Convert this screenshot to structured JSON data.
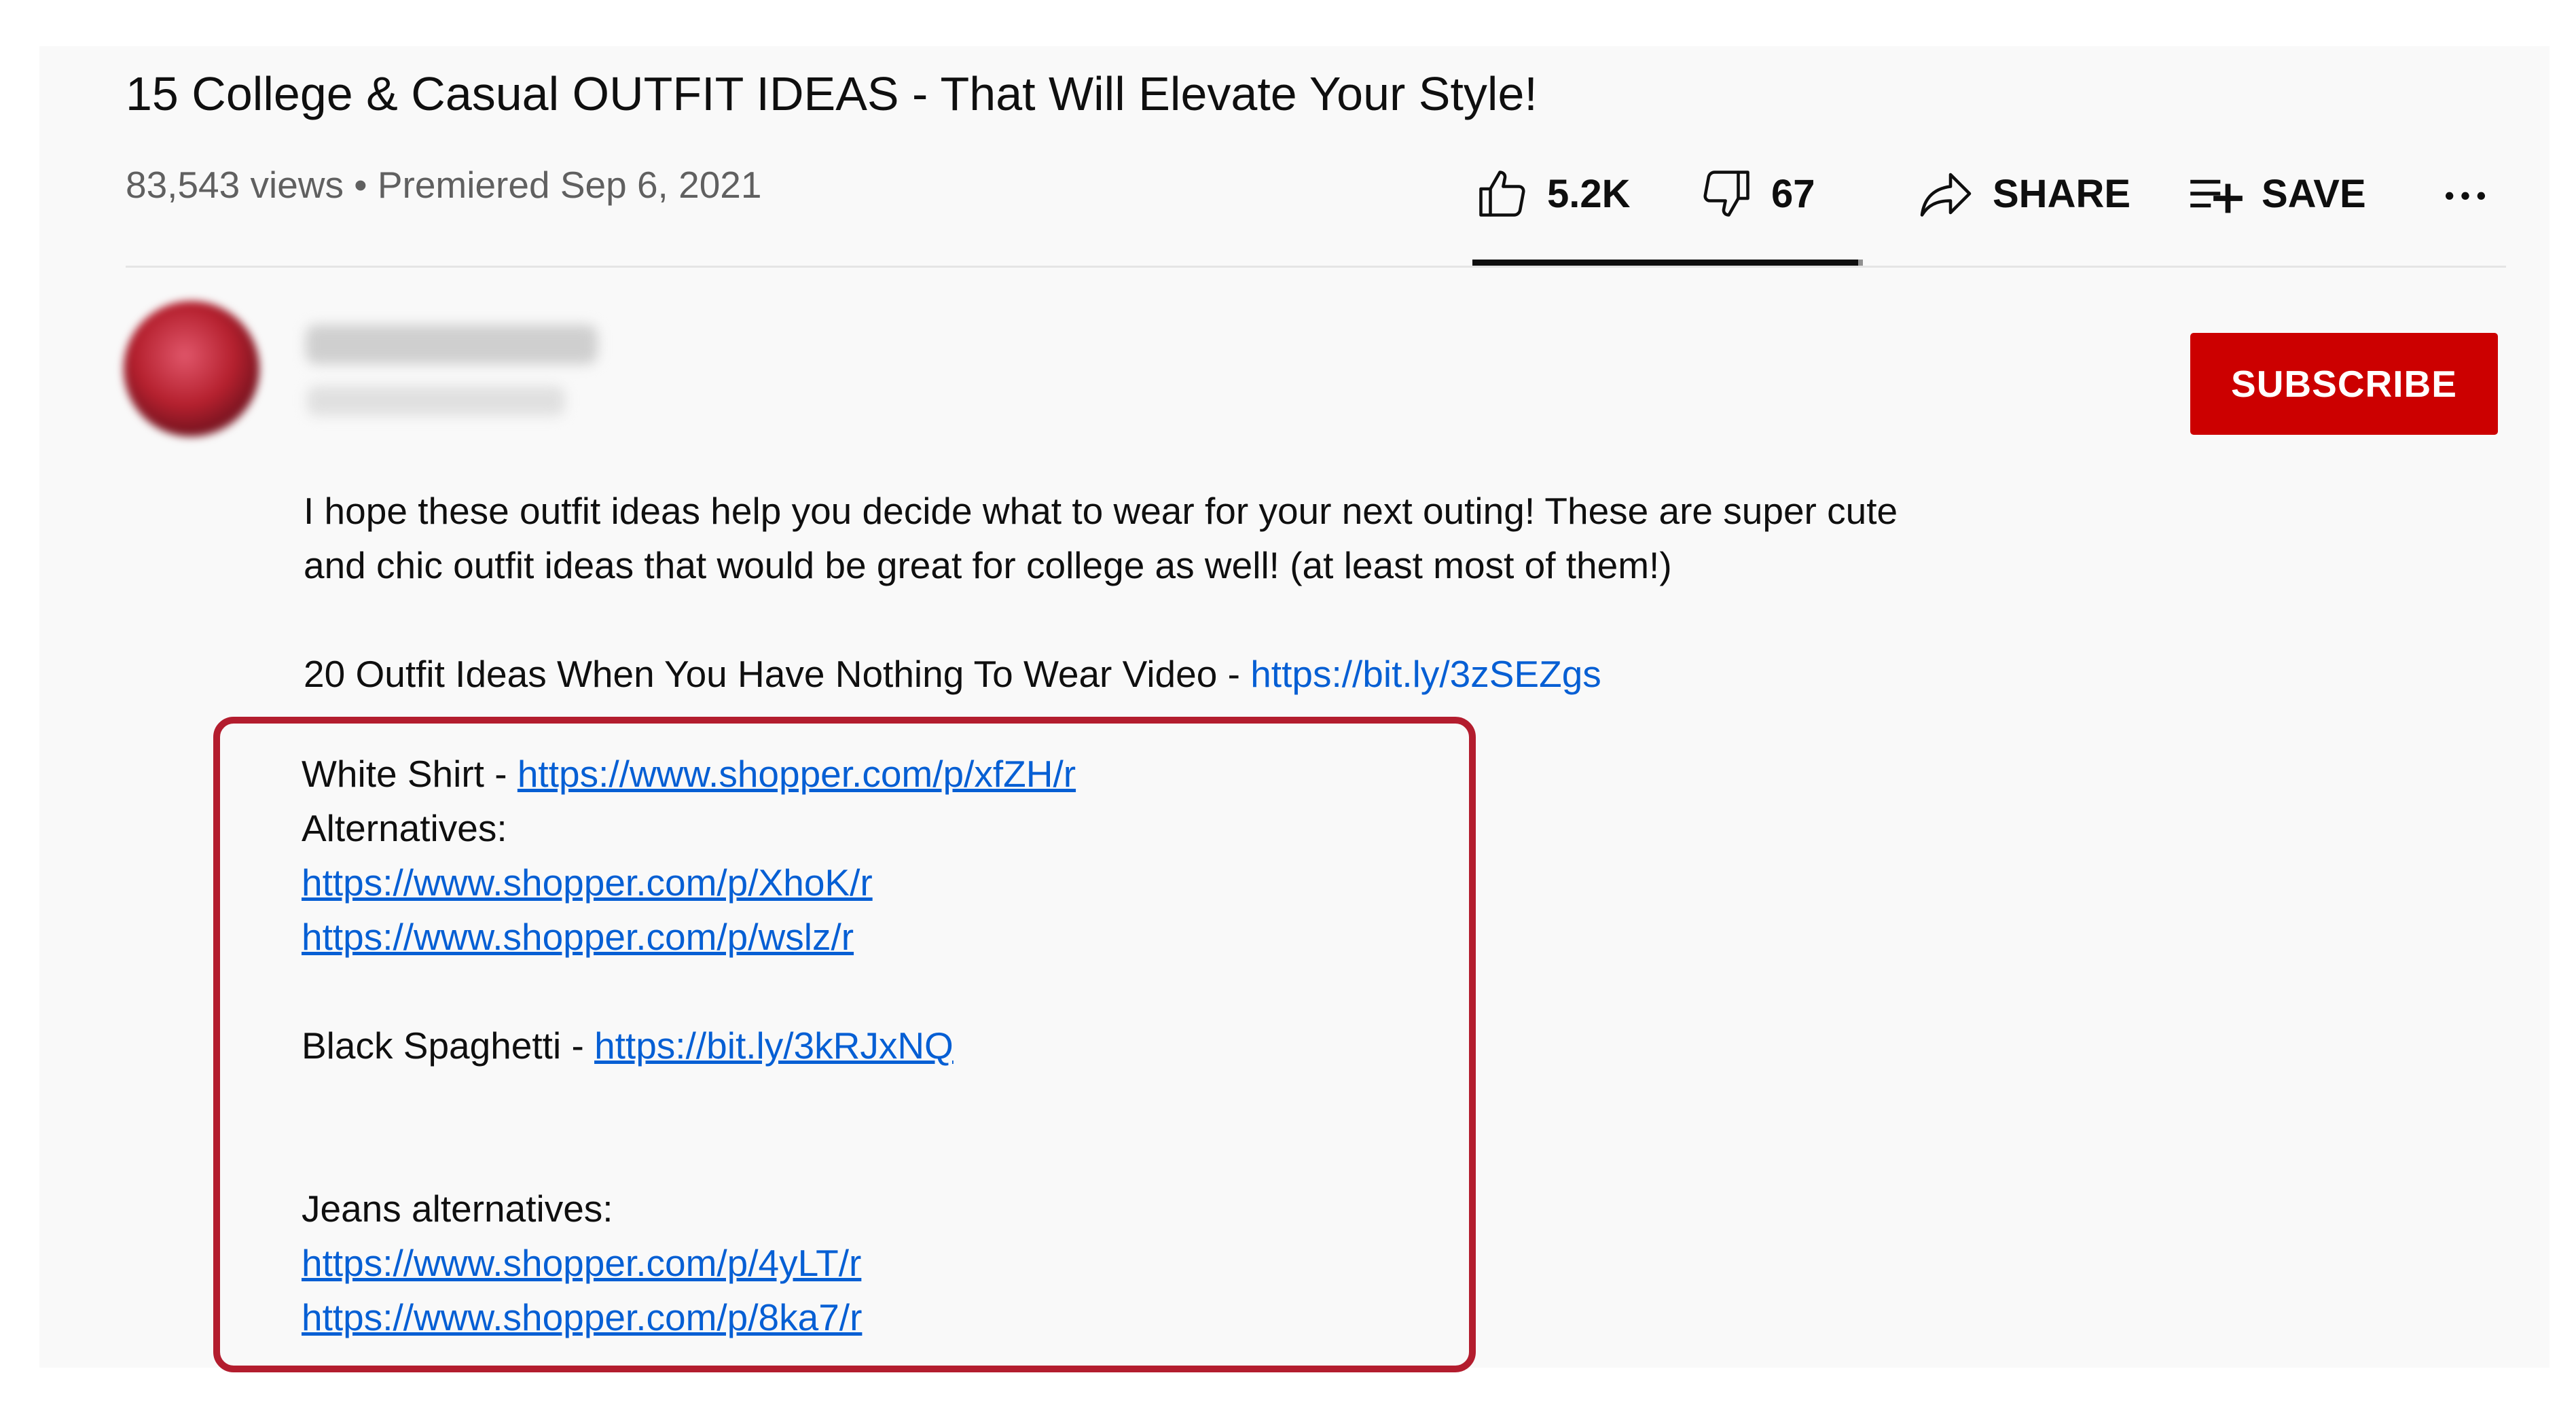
{
  "video": {
    "title": "15 College & Casual OUTFIT IDEAS - That Will Elevate Your Style!",
    "meta": "83,543 views • Premiered Sep 6, 2021"
  },
  "actions": {
    "like_count": "5.2K",
    "dislike_count": "67",
    "share_label": "SHARE",
    "save_label": "SAVE",
    "like_icon": "thumbs-up-icon",
    "dislike_icon": "thumbs-down-icon",
    "share_icon": "share-arrow-icon",
    "save_icon": "playlist-add-icon",
    "more_icon": "more-horizontal-icon"
  },
  "sentiment": {
    "like_fraction": 0.987
  },
  "channel": {
    "subscribe_label": "SUBSCRIBE",
    "subscribe_color": "#cc0000"
  },
  "description": {
    "intro_line1": "I hope these outfit ideas help you decide what to wear for your next outing! These are super cute",
    "intro_line2": "and chic outfit ideas that would be great for college as well! (at least most of them!)",
    "related_text": "20 Outfit Ideas When You Have Nothing To Wear Video - ",
    "related_link": "https://bit.ly/3zSEZgs"
  },
  "highlight": {
    "border_color": "#b31d2e",
    "white_shirt_text": "White Shirt - ",
    "white_shirt_link": "https://www.shopper.com/p/xfZH/r",
    "alternatives_label": "Alternatives:",
    "alt_link_1": "https://www.shopper.com/p/XhoK/r",
    "alt_link_2": "https://www.shopper.com/p/wslz/r",
    "black_spaghetti_text": "Black Spaghetti - ",
    "black_spaghetti_link": "https://bit.ly/3kRJxNQ",
    "jeans_label": "Jeans alternatives:",
    "jeans_link_1": "https://www.shopper.com/p/4yLT/r",
    "jeans_link_2": "https://www.shopper.com/p/8ka7/r"
  },
  "colors": {
    "link": "#065fd4",
    "meta_text": "#606060",
    "panel_bg": "#f9f9f9"
  }
}
